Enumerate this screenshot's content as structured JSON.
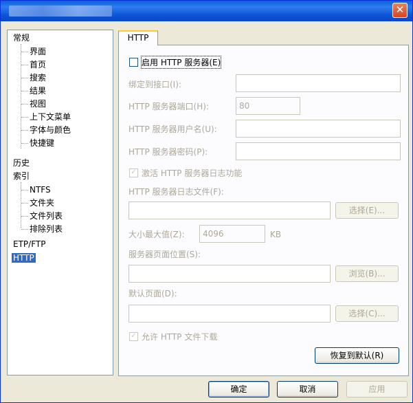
{
  "window": {
    "title": "",
    "close_symbol": "✕"
  },
  "tree": {
    "items": [
      {
        "label": "常规"
      },
      {
        "label": "界面"
      },
      {
        "label": "首页"
      },
      {
        "label": "搜索"
      },
      {
        "label": "结果"
      },
      {
        "label": "视图"
      },
      {
        "label": "上下文菜单"
      },
      {
        "label": "字体与颜色"
      },
      {
        "label": "快捷键"
      },
      {
        "label": "历史"
      },
      {
        "label": "索引"
      },
      {
        "label": "NTFS"
      },
      {
        "label": "文件夹"
      },
      {
        "label": "文件列表"
      },
      {
        "label": "排除列表"
      },
      {
        "label": "ETP/FTP"
      },
      {
        "label": "HTTP"
      }
    ],
    "selected": "HTTP"
  },
  "tab": {
    "label": "HTTP"
  },
  "http": {
    "enable_label": "启用 HTTP 服务器(E)",
    "bind_label": "绑定到接口(I):",
    "bind_value": "",
    "port_label": "HTTP 服务器端口(H):",
    "port_value": "80",
    "username_label": "HTTP 服务器用户名(U):",
    "username_value": "",
    "password_label": "HTTP 服务器密码(P):",
    "password_value": "",
    "log_enable_label": "激活 HTTP 服务器日志功能",
    "log_file_label": "HTTP 服务器日志文件(F):",
    "log_file_value": "",
    "log_browse": "选择(E)...",
    "maxsize_label": "大小最大值(Z):",
    "maxsize_value": "4096",
    "maxsize_unit": "KB",
    "pages_label": "服务器页面位置(S):",
    "pages_value": "",
    "pages_browse": "浏览(B)...",
    "default_label": "默认页面(D):",
    "default_value": "",
    "default_browse": "选择(C)...",
    "allow_download_label": "允许 HTTP 文件下载",
    "restore_defaults": "恢复到默认(R)"
  },
  "footer": {
    "ok": "确定",
    "cancel": "取消",
    "apply": "应用"
  }
}
